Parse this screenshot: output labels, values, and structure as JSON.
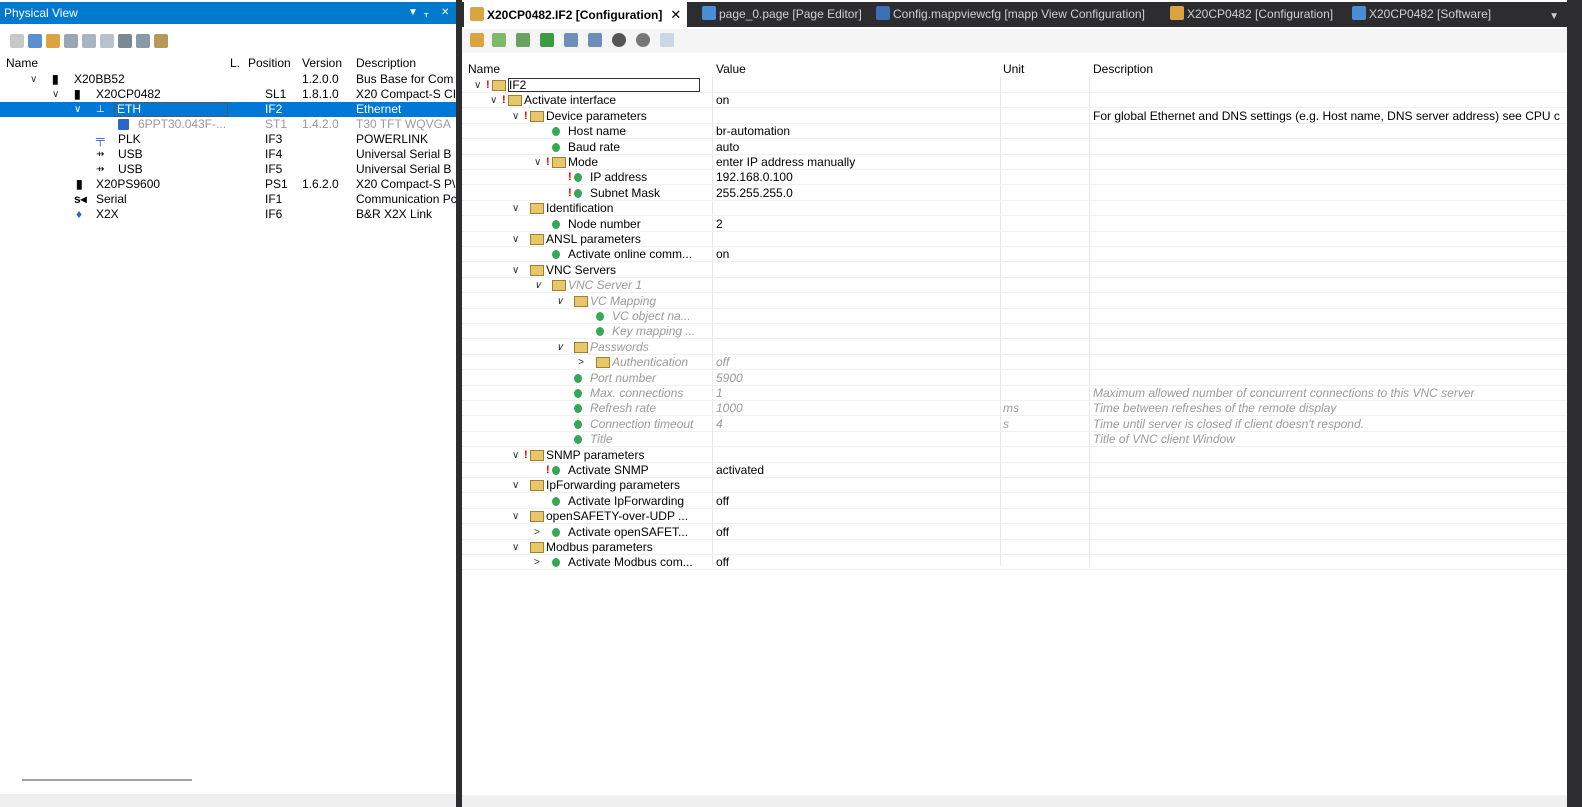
{
  "left_panel": {
    "title": "Physical View",
    "controls": {
      "dropdown": "▼",
      "pin": "📌",
      "close": "✕"
    },
    "columns": {
      "name": "Name",
      "l": "L.",
      "position": "Position",
      "version": "Version",
      "description": "Description"
    },
    "rows": [
      {
        "expander": "∨",
        "name": "X20BB52",
        "position": "",
        "version": "1.2.0.0",
        "description": "Bus Base for Com"
      },
      {
        "expander": "∨",
        "name": "X20CP0482",
        "position": "SL1",
        "version": "1.8.1.0",
        "description": "X20 Compact-S CI"
      },
      {
        "expander": "∨",
        "name": "ETH",
        "position": "IF2",
        "version": "",
        "description": "Ethernet"
      },
      {
        "expander": "",
        "name": "6PPT30.043F-...",
        "position": "ST1",
        "version": "1.4.2.0",
        "description": "T30 TFT WQVGA"
      },
      {
        "expander": "",
        "name": "PLK",
        "position": "IF3",
        "version": "",
        "description": "POWERLINK"
      },
      {
        "expander": "",
        "name": "USB",
        "position": "IF4",
        "version": "",
        "description": "Universal Serial B"
      },
      {
        "expander": "",
        "name": "USB",
        "position": "IF5",
        "version": "",
        "description": "Universal Serial B"
      },
      {
        "expander": "",
        "name": "X20PS9600",
        "position": "PS1",
        "version": "1.6.2.0",
        "description": "X20 Compact-S P\\"
      },
      {
        "expander": "",
        "name": "Serial",
        "position": "IF1",
        "version": "",
        "description": "Communication Pc"
      },
      {
        "expander": "",
        "name": "X2X",
        "position": "IF6",
        "version": "",
        "description": "B&R X2X Link"
      }
    ]
  },
  "tabs": [
    {
      "label": "X20CP0482.IF2 [Configuration]",
      "close": "✕",
      "active": true
    },
    {
      "label": "page_0.page [Page Editor]"
    },
    {
      "label": "Config.mappviewcfg [mapp View Configuration]"
    },
    {
      "label": "X20CP0482 [Configuration]"
    },
    {
      "label": "X20CP0482 [Software]"
    }
  ],
  "tab_overflow": "▼",
  "config": {
    "columns": {
      "name": "Name",
      "value": "Value",
      "unit": "Unit",
      "description": "Description"
    },
    "rows": [
      {
        "expander": "∨",
        "name": "IF2",
        "value": "",
        "unit": "",
        "description": ""
      },
      {
        "expander": "∨",
        "name": "Activate interface",
        "value": "on",
        "unit": "",
        "description": ""
      },
      {
        "expander": "∨",
        "name": "Device parameters",
        "value": "",
        "unit": "",
        "description": "For global Ethernet and DNS settings (e.g. Host name, DNS server address) see CPU c"
      },
      {
        "expander": "",
        "name": "Host name",
        "value": "br-automation",
        "unit": "",
        "description": ""
      },
      {
        "expander": "",
        "name": "Baud rate",
        "value": "auto",
        "unit": "",
        "description": ""
      },
      {
        "expander": "∨",
        "name": "Mode",
        "value": "enter IP address manually",
        "unit": "",
        "description": ""
      },
      {
        "expander": "",
        "name": "IP address",
        "value": "192.168.0.100",
        "unit": "",
        "description": ""
      },
      {
        "expander": "",
        "name": "Subnet Mask",
        "value": "255.255.255.0",
        "unit": "",
        "description": ""
      },
      {
        "expander": "∨",
        "name": "Identification",
        "value": "",
        "unit": "",
        "description": ""
      },
      {
        "expander": "",
        "name": "Node number",
        "value": "2",
        "unit": "",
        "description": ""
      },
      {
        "expander": "∨",
        "name": "ANSL parameters",
        "value": "",
        "unit": "",
        "description": ""
      },
      {
        "expander": "",
        "name": "Activate online comm...",
        "value": "on",
        "unit": "",
        "description": ""
      },
      {
        "expander": "∨",
        "name": "VNC Servers",
        "value": "",
        "unit": "",
        "description": ""
      },
      {
        "expander": "∨",
        "name": "VNC Server 1",
        "value": "",
        "unit": "",
        "description": ""
      },
      {
        "expander": "∨",
        "name": "VC Mapping",
        "value": "",
        "unit": "",
        "description": ""
      },
      {
        "expander": "",
        "name": "VC object na...",
        "value": "",
        "unit": "",
        "description": ""
      },
      {
        "expander": "",
        "name": "Key mapping ...",
        "value": "",
        "unit": "",
        "description": ""
      },
      {
        "expander": "∨",
        "name": "Passwords",
        "value": "",
        "unit": "",
        "description": ""
      },
      {
        "expander": ">",
        "name": "Authentication",
        "value": "off",
        "unit": "",
        "description": ""
      },
      {
        "expander": "",
        "name": "Port number",
        "value": "5900",
        "unit": "",
        "description": ""
      },
      {
        "expander": "",
        "name": "Max. connections",
        "value": "1",
        "unit": "",
        "description": "Maximum allowed number of concurrent connections to this VNC server"
      },
      {
        "expander": "",
        "name": "Refresh rate",
        "value": "1000",
        "unit": "ms",
        "description": "Time between refreshes of the remote display"
      },
      {
        "expander": "",
        "name": "Connection timeout",
        "value": "4",
        "unit": "s",
        "description": "Time until server is closed if client doesn't respond."
      },
      {
        "expander": "",
        "name": "Title",
        "value": "",
        "unit": "",
        "description": "Title of VNC client Window"
      },
      {
        "expander": "∨",
        "name": "SNMP parameters",
        "value": "",
        "unit": "",
        "description": ""
      },
      {
        "expander": "",
        "name": "Activate SNMP",
        "value": "activated",
        "unit": "",
        "description": ""
      },
      {
        "expander": "∨",
        "name": "IpForwarding parameters",
        "value": "",
        "unit": "",
        "description": ""
      },
      {
        "expander": "",
        "name": "Activate IpForwarding",
        "value": "off",
        "unit": "",
        "description": ""
      },
      {
        "expander": "∨",
        "name": "openSAFETY-over-UDP ...",
        "value": "",
        "unit": "",
        "description": ""
      },
      {
        "expander": ">",
        "name": "Activate openSAFET...",
        "value": "off",
        "unit": "",
        "description": ""
      },
      {
        "expander": "∨",
        "name": "Modbus parameters",
        "value": "",
        "unit": "",
        "description": ""
      },
      {
        "expander": ">",
        "name": "Activate Modbus com...",
        "value": "off",
        "unit": "",
        "description": ""
      }
    ]
  },
  "colors": {
    "title_bar": "#007acc",
    "selection": "#0078d7",
    "tab_strip": "#2d2d30",
    "param_icon": "#34a853",
    "warning": "#e00000"
  }
}
